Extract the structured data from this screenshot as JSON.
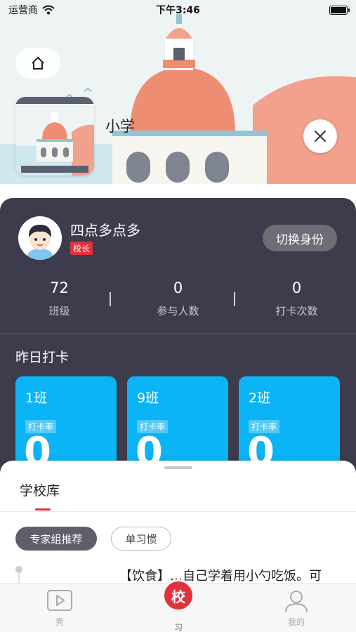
{
  "status_bar": {
    "carrier": "运营商",
    "time": "下午3:46"
  },
  "header": {
    "home_icon": "home-icon",
    "school_name": "小学",
    "close_icon": "close-icon"
  },
  "profile": {
    "name": "四点多点多",
    "role": "校长",
    "switch_label": "切换身份"
  },
  "stats": [
    {
      "value": "72",
      "label": "班级"
    },
    {
      "value": "0",
      "label": "参与人数"
    },
    {
      "value": "0",
      "label": "打卡次数"
    }
  ],
  "yesterday": {
    "title": "昨日打卡",
    "classes": [
      {
        "name": "1班",
        "rate_label": "打卡率",
        "rate_value": "0"
      },
      {
        "name": "9班",
        "rate_label": "打卡率",
        "rate_value": "0"
      },
      {
        "name": "2班",
        "rate_label": "打卡率",
        "rate_value": "0"
      }
    ]
  },
  "sheet": {
    "title": "学校库",
    "chips": [
      "专家组推荐",
      "单习惯"
    ],
    "article": "【饮食】…自己学着用小勺吃饭。可"
  },
  "tabbar": {
    "left_label": "秀",
    "center_badge": "校",
    "center_label": "习",
    "right_label": "我的"
  },
  "colors": {
    "accent_red": "#e0323a",
    "card_blue": "#0ab4f5",
    "dark_panel": "#3c3c4c"
  }
}
